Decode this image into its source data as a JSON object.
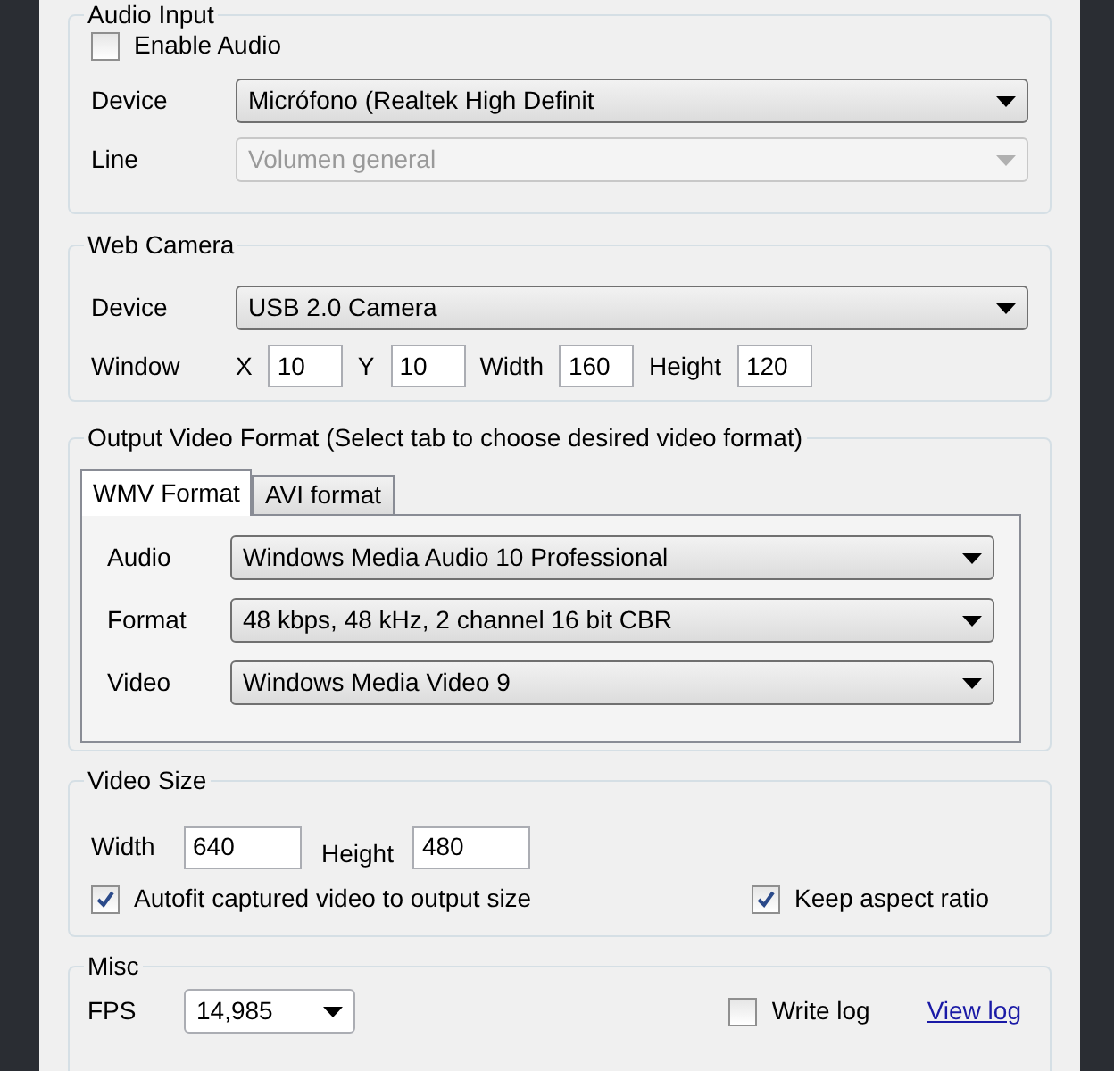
{
  "audio_input": {
    "title": "Audio Input",
    "enable_audio": {
      "label": "Enable Audio",
      "checked": false
    },
    "device": {
      "label": "Device",
      "value": "Micrófono (Realtek High Definit",
      "disabled": false
    },
    "line": {
      "label": "Line",
      "value": "Volumen general",
      "disabled": true
    }
  },
  "web_camera": {
    "title": "Web Camera",
    "device": {
      "label": "Device",
      "value": "USB 2.0 Camera",
      "disabled": false
    },
    "window": {
      "label": "Window",
      "fields": [
        {
          "label": "X",
          "value": "10"
        },
        {
          "label": "Y",
          "value": "10"
        },
        {
          "label": "Width",
          "value": "160"
        },
        {
          "label": "Height",
          "value": "120"
        }
      ]
    }
  },
  "output_video_format": {
    "title": "Output Video Format (Select tab to choose desired video format)",
    "tabs": [
      {
        "label": "WMV Format",
        "selected": true
      },
      {
        "label": "AVI format",
        "selected": false
      }
    ],
    "rows": [
      {
        "label": "Audio",
        "value": "Windows Media Audio 10 Professional"
      },
      {
        "label": "Format",
        "value": "48 kbps, 48 kHz, 2 channel 16 bit CBR"
      },
      {
        "label": "Video",
        "value": "Windows Media Video 9"
      }
    ]
  },
  "video_size": {
    "title": "Video Size",
    "width": {
      "label": "Width",
      "value": "640"
    },
    "height": {
      "label": "Height",
      "value": "480"
    },
    "checkboxes": [
      {
        "label": "Autofit captured video to output size",
        "checked": true
      },
      {
        "label": "Keep aspect ratio",
        "checked": true
      }
    ]
  },
  "misc": {
    "title": "Misc",
    "fps": {
      "label": "FPS",
      "value": "14,985"
    },
    "write_log": {
      "label": "Write log",
      "checked": false
    },
    "view_log": "View log"
  }
}
